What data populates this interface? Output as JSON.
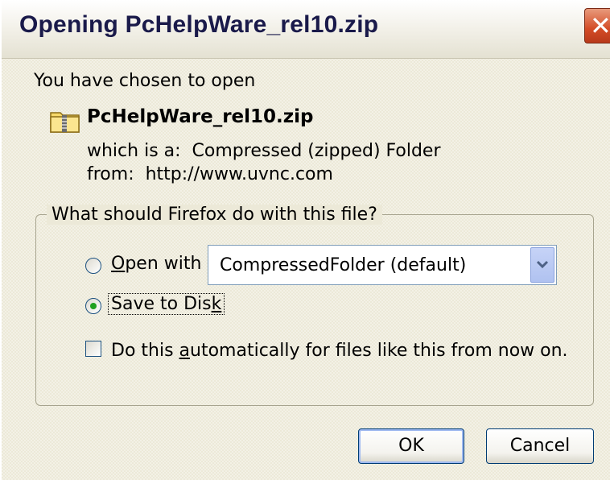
{
  "window": {
    "title": "Opening PcHelpWare_rel10.zip",
    "close_icon": "close-icon"
  },
  "info": {
    "intro": "You have chosen to open",
    "filename": "PcHelpWare_rel10.zip",
    "type_prefix": "which is a:",
    "type_value": "Compressed (zipped) Folder",
    "from_prefix": "from:",
    "from_value": "http://www.uvnc.com",
    "file_icon": "folder-zip-icon"
  },
  "action_group": {
    "legend": "What should Firefox do with this file?",
    "open_with": {
      "label_accel": "O",
      "label_rest": "pen with",
      "selected": false
    },
    "app_select": {
      "value": "CompressedFolder (default)"
    },
    "save_to_disk": {
      "label_pre": "Save to Dis",
      "label_accel": "k",
      "selected": true
    },
    "auto": {
      "label_pre": "Do this ",
      "label_accel": "a",
      "label_rest": "utomatically for files like this from now on.",
      "checked": false
    }
  },
  "buttons": {
    "ok": "OK",
    "cancel": "Cancel"
  },
  "colors": {
    "title_text": "#1a1a4a",
    "close_button": "#d34b26",
    "radio_dot": "#21a121",
    "button_border": "#003c74"
  }
}
